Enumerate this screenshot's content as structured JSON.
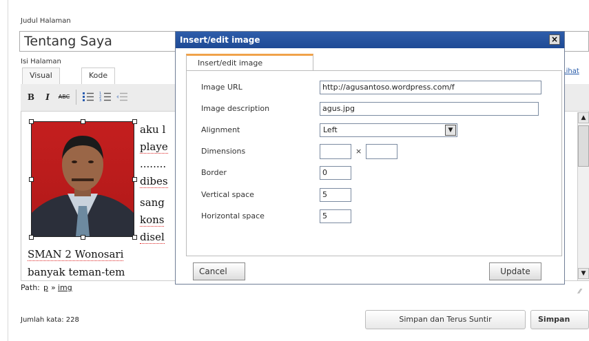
{
  "page": {
    "title_label": "Judul Halaman",
    "title_value": "Tentang Saya",
    "content_label": "Isi Halaman",
    "tabs": [
      {
        "label": "Visual"
      },
      {
        "label": "Kode"
      }
    ],
    "insert_link": "Lihat"
  },
  "toolbar": {
    "bold_label": "B",
    "italic_label": "I",
    "strike_label": "ABC",
    "icons": [
      "bold-icon",
      "italic-icon",
      "strikethrough-icon",
      "bullet-list-icon",
      "numbered-list-icon",
      "outdent-icon"
    ]
  },
  "editor": {
    "lines": [
      "aku l",
      "playe",
      "........",
      "dibes",
      "sang",
      "kons",
      "disel"
    ],
    "line_sman": "SMAN 2 Wonosari",
    "line_banyak": "banyak teman-tem",
    "path_label": "Path:",
    "path_p": "p",
    "path_sep": "»",
    "path_img": "img"
  },
  "footer": {
    "word_count": "Jumlah kata: 228",
    "save_continue": "Simpan dan Terus Suntir",
    "save": "Simpan"
  },
  "dialog": {
    "title": "Insert/edit image",
    "close": "×",
    "tab": "Insert/edit image",
    "fields": {
      "url_label": "Image URL",
      "url_value": "http://agusantoso.wordpress.com/f",
      "desc_label": "Image description",
      "desc_value": "agus.jpg",
      "align_label": "Alignment",
      "align_value": "Left",
      "dim_label": "Dimensions",
      "dim_x": "×",
      "dim_width": "",
      "dim_height": "",
      "border_label": "Border",
      "border_value": "0",
      "vspace_label": "Vertical space",
      "vspace_value": "5",
      "hspace_label": "Horizontal space",
      "hspace_value": "5"
    },
    "cancel": "Cancel",
    "update": "Update"
  },
  "colors": {
    "dialog_title_bg": "#2e5daa",
    "tab_accent": "#f0a24a",
    "link": "#2358a8",
    "photo_bg": "#c41f1f"
  }
}
